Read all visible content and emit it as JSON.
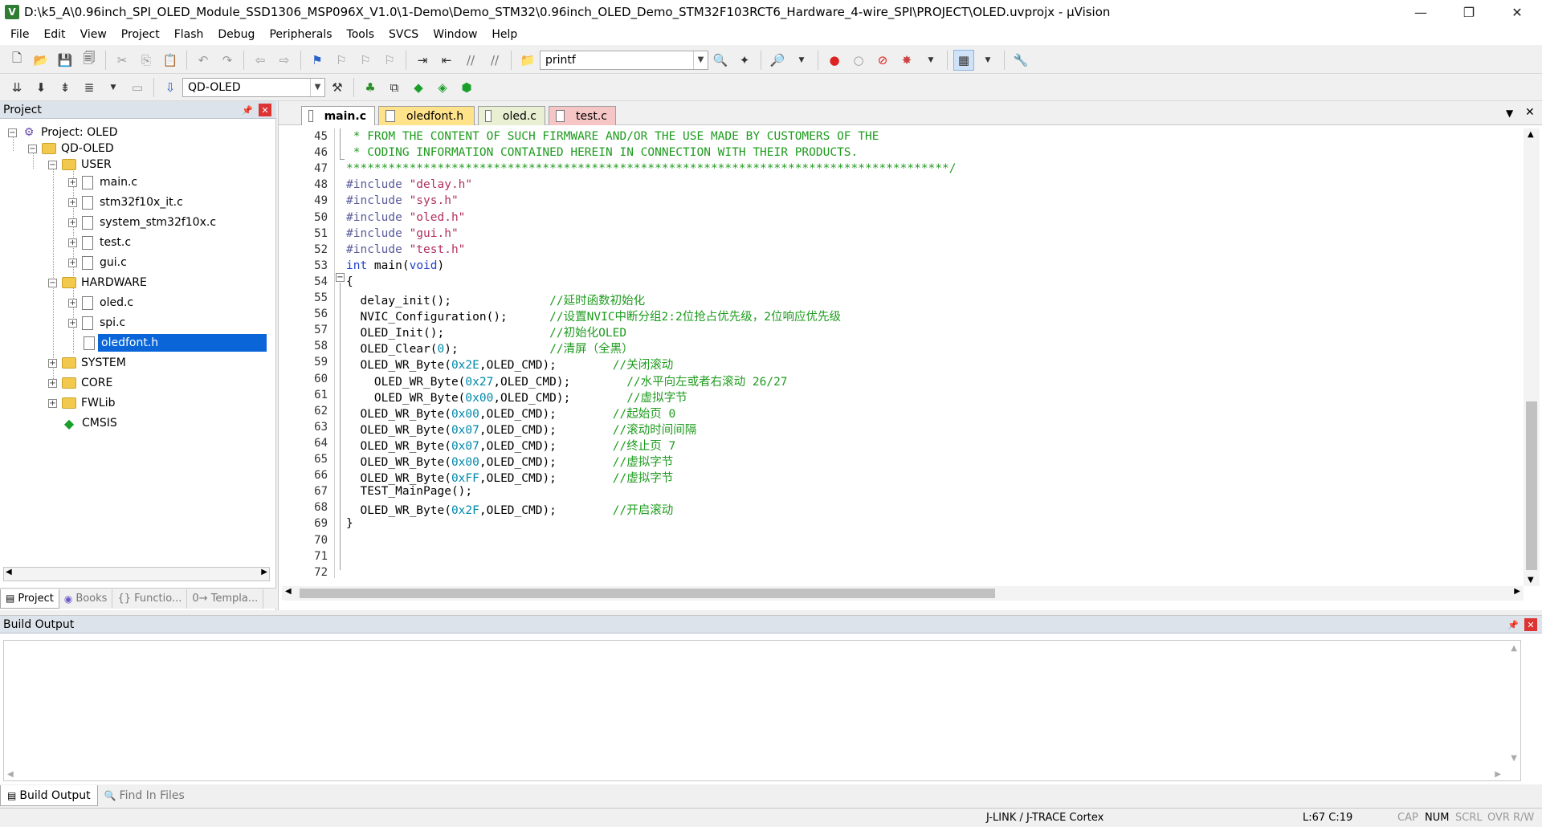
{
  "window": {
    "title": "D:\\k5_A\\0.96inch_SPI_OLED_Module_SSD1306_MSP096X_V1.0\\1-Demo\\Demo_STM32\\0.96inch_OLED_Demo_STM32F103RCT6_Hardware_4-wire_SPI\\PROJECT\\OLED.uvprojx - µVision",
    "minimize": "—",
    "restore": "❐",
    "close": "✕"
  },
  "menu": [
    "File",
    "Edit",
    "View",
    "Project",
    "Flash",
    "Debug",
    "Peripherals",
    "Tools",
    "SVCS",
    "Window",
    "Help"
  ],
  "toolbar1": {
    "find_value": "printf"
  },
  "toolbar2": {
    "target_value": "QD-OLED"
  },
  "project_panel": {
    "title": "Project",
    "tree": {
      "root": "Project: OLED",
      "target": "QD-OLED",
      "groups": {
        "user": "USER",
        "user_files": [
          "main.c",
          "stm32f10x_it.c",
          "system_stm32f10x.c",
          "test.c",
          "gui.c"
        ],
        "hardware": "HARDWARE",
        "hardware_files": [
          "oled.c",
          "spi.c",
          "oledfont.h"
        ],
        "system": "SYSTEM",
        "core": "CORE",
        "fwlib": "FWLib",
        "cmsis": "CMSIS"
      },
      "selected": "oledfont.h"
    },
    "tabs": [
      "Project",
      "Books",
      "{} Functio...",
      "0→ Templa..."
    ]
  },
  "editor": {
    "tabs": [
      "main.c",
      "oledfont.h",
      "oled.c",
      "test.c"
    ],
    "active_tab": "main.c",
    "lines": [
      {
        "n": "45",
        "parts": [
          {
            "c": "cm",
            "t": " * FROM THE CONTENT OF SUCH FIRMWARE AND/OR THE USE MADE BY CUSTOMERS OF THE"
          }
        ]
      },
      {
        "n": "46",
        "parts": [
          {
            "c": "cm",
            "t": " * CODING INFORMATION CONTAINED HEREIN IN CONNECTION WITH THEIR PRODUCTS."
          }
        ]
      },
      {
        "n": "47",
        "parts": [
          {
            "c": "cm",
            "t": "**************************************************************************************/"
          }
        ]
      },
      {
        "n": "48",
        "parts": [
          {
            "c": "pp",
            "t": "#include "
          },
          {
            "c": "str",
            "t": "\"delay.h\""
          }
        ]
      },
      {
        "n": "49",
        "parts": [
          {
            "c": "pp",
            "t": "#include "
          },
          {
            "c": "str",
            "t": "\"sys.h\""
          }
        ]
      },
      {
        "n": "50",
        "parts": [
          {
            "c": "pp",
            "t": "#include "
          },
          {
            "c": "str",
            "t": "\"oled.h\""
          }
        ]
      },
      {
        "n": "51",
        "parts": [
          {
            "c": "pp",
            "t": "#include "
          },
          {
            "c": "str",
            "t": "\"gui.h\""
          }
        ]
      },
      {
        "n": "52",
        "parts": [
          {
            "c": "pp",
            "t": "#include "
          },
          {
            "c": "str",
            "t": "\"test.h\""
          }
        ]
      },
      {
        "n": "53",
        "parts": [
          {
            "c": "kw",
            "t": "int"
          },
          {
            "c": "",
            "t": " main("
          },
          {
            "c": "kw",
            "t": "void"
          },
          {
            "c": "",
            "t": ")"
          }
        ]
      },
      {
        "n": "54",
        "parts": [
          {
            "c": "",
            "t": "{"
          }
        ]
      },
      {
        "n": "55",
        "parts": [
          {
            "c": "",
            "t": "  delay_init();              "
          },
          {
            "c": "cm",
            "t": "//延时函数初始化"
          }
        ]
      },
      {
        "n": "56",
        "parts": [
          {
            "c": "",
            "t": "  NVIC_Configuration();      "
          },
          {
            "c": "cm",
            "t": "//设置NVIC中断分组2:2位抢占优先级，2位响应优先级"
          }
        ]
      },
      {
        "n": "57",
        "parts": [
          {
            "c": "",
            "t": "  OLED_Init();               "
          },
          {
            "c": "cm",
            "t": "//初始化OLED"
          }
        ]
      },
      {
        "n": "58",
        "parts": [
          {
            "c": "",
            "t": "  OLED_Clear("
          },
          {
            "c": "num",
            "t": "0"
          },
          {
            "c": "",
            "t": ");             "
          },
          {
            "c": "cm",
            "t": "//清屏（全黑）"
          }
        ]
      },
      {
        "n": "59",
        "parts": [
          {
            "c": "",
            "t": "  OLED_WR_Byte("
          },
          {
            "c": "num",
            "t": "0x2E"
          },
          {
            "c": "",
            "t": ",OLED_CMD);        "
          },
          {
            "c": "cm",
            "t": "//关闭滚动"
          }
        ]
      },
      {
        "n": "60",
        "parts": [
          {
            "c": "",
            "t": "    OLED_WR_Byte("
          },
          {
            "c": "num",
            "t": "0x27"
          },
          {
            "c": "",
            "t": ",OLED_CMD);        "
          },
          {
            "c": "cm",
            "t": "//水平向左或者右滚动 26/27"
          }
        ]
      },
      {
        "n": "61",
        "parts": [
          {
            "c": "",
            "t": "    OLED_WR_Byte("
          },
          {
            "c": "num",
            "t": "0x00"
          },
          {
            "c": "",
            "t": ",OLED_CMD);        "
          },
          {
            "c": "cm",
            "t": "//虚拟字节"
          }
        ]
      },
      {
        "n": "62",
        "parts": [
          {
            "c": "",
            "t": "  OLED_WR_Byte("
          },
          {
            "c": "num",
            "t": "0x00"
          },
          {
            "c": "",
            "t": ",OLED_CMD);        "
          },
          {
            "c": "cm",
            "t": "//起始页 0"
          }
        ]
      },
      {
        "n": "63",
        "parts": [
          {
            "c": "",
            "t": "  OLED_WR_Byte("
          },
          {
            "c": "num",
            "t": "0x07"
          },
          {
            "c": "",
            "t": ",OLED_CMD);        "
          },
          {
            "c": "cm",
            "t": "//滚动时间间隔"
          }
        ]
      },
      {
        "n": "64",
        "parts": [
          {
            "c": "",
            "t": "  OLED_WR_Byte("
          },
          {
            "c": "num",
            "t": "0x07"
          },
          {
            "c": "",
            "t": ",OLED_CMD);        "
          },
          {
            "c": "cm",
            "t": "//终止页 7"
          }
        ]
      },
      {
        "n": "65",
        "parts": [
          {
            "c": "",
            "t": "  OLED_WR_Byte("
          },
          {
            "c": "num",
            "t": "0x00"
          },
          {
            "c": "",
            "t": ",OLED_CMD);        "
          },
          {
            "c": "cm",
            "t": "//虚拟字节"
          }
        ]
      },
      {
        "n": "66",
        "parts": [
          {
            "c": "",
            "t": "  OLED_WR_Byte("
          },
          {
            "c": "num",
            "t": "0xFF"
          },
          {
            "c": "",
            "t": ",OLED_CMD);        "
          },
          {
            "c": "cm",
            "t": "//虚拟字节"
          }
        ]
      },
      {
        "n": "67",
        "parts": [
          {
            "c": "",
            "t": "  TEST_MainPage();"
          }
        ]
      },
      {
        "n": "68",
        "parts": [
          {
            "c": "",
            "t": "  OLED_WR_Byte("
          },
          {
            "c": "num",
            "t": "0x2F"
          },
          {
            "c": "",
            "t": ",OLED_CMD);        "
          },
          {
            "c": "cm",
            "t": "//开启滚动"
          }
        ]
      },
      {
        "n": "69",
        "parts": [
          {
            "c": "",
            "t": "}"
          }
        ]
      },
      {
        "n": "70",
        "parts": []
      },
      {
        "n": "71",
        "parts": []
      },
      {
        "n": "72",
        "parts": []
      }
    ]
  },
  "build_panel": {
    "title": "Build Output",
    "tabs": [
      "Build Output",
      "Find In Files"
    ]
  },
  "status": {
    "debugger": "J-LINK / J-TRACE Cortex",
    "position": "L:67 C:19",
    "cap": "CAP",
    "num": "NUM",
    "scrl": "SCRL",
    "ovr": "OVR",
    "rw": "R/W"
  },
  "colors": {
    "comment": "#1e9b1e",
    "string": "#b03060",
    "keyword": "#2040c8",
    "number": "#0088aa",
    "selection": "#0a66d8"
  }
}
